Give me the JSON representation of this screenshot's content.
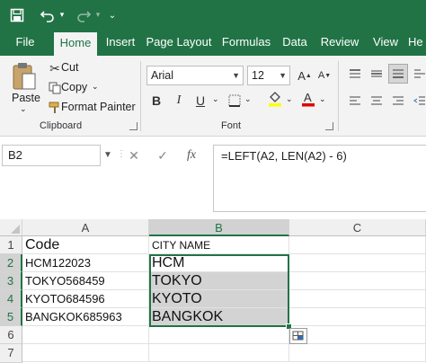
{
  "colors": {
    "brand": "#217346",
    "selection_fill": "#d3d3d3"
  },
  "qat": {
    "icons": [
      "save-icon",
      "undo-icon",
      "redo-icon",
      "customize-icon"
    ]
  },
  "tabs": [
    {
      "label": "File"
    },
    {
      "label": "Home"
    },
    {
      "label": "Insert"
    },
    {
      "label": "Page Layout"
    },
    {
      "label": "Formulas"
    },
    {
      "label": "Data"
    },
    {
      "label": "Review"
    },
    {
      "label": "View"
    },
    {
      "label": "He"
    }
  ],
  "ribbon": {
    "clipboard": {
      "paste": "Paste",
      "cut": "Cut",
      "copy": "Copy",
      "format_painter": "Format Painter",
      "label": "Clipboard"
    },
    "font": {
      "family": "Arial",
      "size": "12",
      "bold": "B",
      "italic": "I",
      "underline": "U",
      "label": "Font"
    }
  },
  "formula_bar": {
    "name_box": "B2",
    "cancel": "✕",
    "enter": "✓",
    "fx": "fx",
    "formula": "=LEFT(A2, LEN(A2) - 6)"
  },
  "grid": {
    "columns": [
      "A",
      "B",
      "C"
    ],
    "rows": [
      "1",
      "2",
      "3",
      "4",
      "5",
      "6",
      "7"
    ],
    "cells": {
      "a1": "Code",
      "b1": "CITY NAME",
      "a2": "HCM122023",
      "b2": "HCM",
      "a3": "TOKYO568459",
      "b3": "TOKYO",
      "a4": "KYOTO684596",
      "b4": "KYOTO",
      "a5": "BANGKOK685963",
      "b5": "BANGKOK"
    }
  }
}
